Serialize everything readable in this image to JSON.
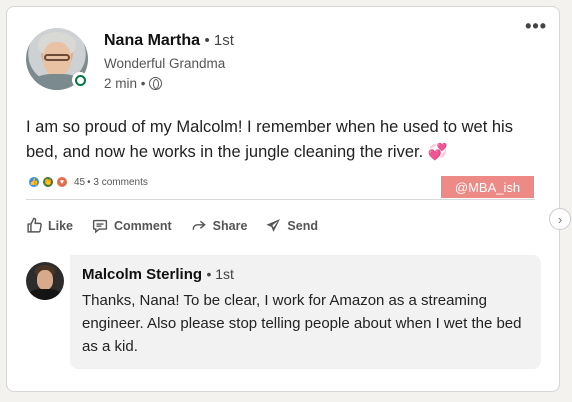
{
  "post": {
    "author_name": "Nana Martha",
    "author_degree": "• 1st",
    "author_title": "Wonderful Grandma",
    "time": "2 min •",
    "text": "I am so proud of my Malcolm! I remember when he used to wet his bed, and now he works in the jungle cleaning the river.",
    "text_emoji": "💞",
    "reaction_count": "45",
    "comment_count": "• 3 comments"
  },
  "watermark": "@MBA_ish",
  "actions": [
    {
      "label": "Like",
      "icon": "like-icon"
    },
    {
      "label": "Comment",
      "icon": "comment-icon"
    },
    {
      "label": "Share",
      "icon": "share-icon"
    },
    {
      "label": "Send",
      "icon": "send-icon"
    }
  ],
  "comment": {
    "author_name": "Malcolm Sterling",
    "author_degree": "• 1st",
    "text": "Thanks, Nana! To be clear, I work for Amazon as a streaming engineer. Also please stop telling people about when I wet the bed as a kid."
  },
  "colors": {
    "online": "#057642",
    "watermark_bg": "#ee8a86",
    "like_reaction": "#378fe9",
    "celebrate_reaction": "#44712e",
    "love_reaction": "#df704d"
  }
}
